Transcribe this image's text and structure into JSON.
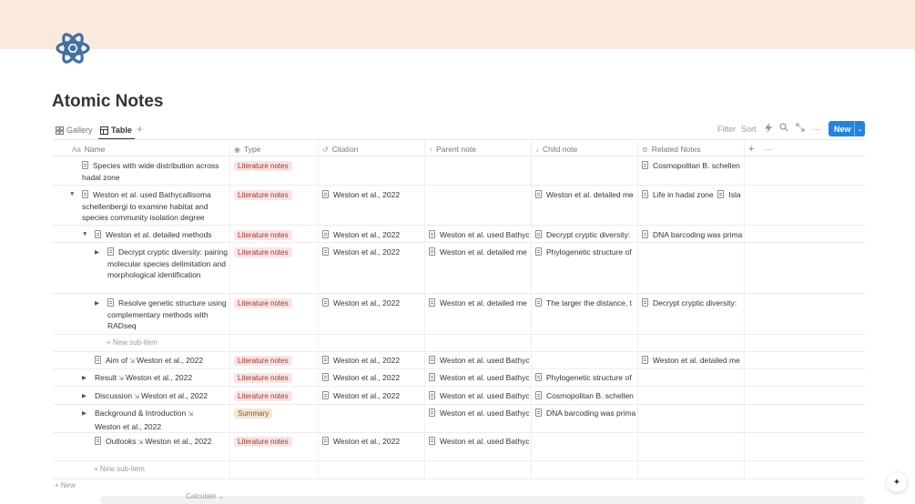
{
  "page": {
    "title": "Atomic Notes",
    "icon": "atom-icon"
  },
  "views": {
    "gallery": "Gallery",
    "table": "Table",
    "add": "+"
  },
  "toolbar": {
    "filter": "Filter",
    "sort": "Sort",
    "new": "New",
    "more": "···"
  },
  "columns": {
    "name": "Name",
    "name_prefix": "Aa",
    "type": "Type",
    "citation": "Citation",
    "parent": "Parent note",
    "child": "Child note",
    "related": "Related Notes",
    "add": "+",
    "more": "···"
  },
  "rows": [
    {
      "name": "Species with wide distribution across hadal zone",
      "type": "Literature notes",
      "citation": "",
      "parent": "",
      "child": "",
      "related": [
        "Cosmopolitan B. schellen"
      ]
    },
    {
      "name": "Weston et al. used Bathycallisoma schellenbergi to examine habitat and species community isolation degree",
      "type": "Literature notes",
      "citation": "Weston et al., 2022",
      "parent": "",
      "child": "Weston et al. detailed me",
      "related": [
        "Life in hadal zone",
        "Isla"
      ]
    },
    {
      "name": "Weston et al. detailed methods",
      "type": "Literature notes",
      "citation": "Weston et al., 2022",
      "parent": "Weston et al. used Bathyc",
      "child": "Decrypt cryptic diversity:",
      "related": [
        "DNA barcoding was prima"
      ]
    },
    {
      "name": "Decrypt cryptic diversity: pairing molecular species delimitation and morphological identification",
      "type": "Literature notes",
      "citation": "Weston et al., 2022",
      "parent": "Weston et al. detailed me",
      "child": "Phylogenetic structure of",
      "related": []
    },
    {
      "name": "Resolve genetic structure using complementary methods with RADseq",
      "type": "Literature notes",
      "citation": "Weston et al., 2022",
      "parent": "Weston et al. detailed me",
      "child": "The larger the distance, t",
      "related": [
        "Decrypt cryptic diversity:"
      ]
    },
    {
      "name_a": "Aim of",
      "name_b": "Weston et al., 2022",
      "type": "Literature notes",
      "citation": "Weston et al., 2022",
      "parent": "Weston et al. used Bathyc",
      "child": "",
      "related": [
        "Weston et al. detailed me"
      ]
    },
    {
      "name_a": "Result",
      "name_b": "Weston et al., 2022",
      "type": "Literature notes",
      "citation": "Weston et al., 2022",
      "parent": "Weston et al. used Bathyc",
      "child": "Phylogenetic structure of",
      "related": []
    },
    {
      "name_a": "Discussion",
      "name_b": "Weston et al., 2022",
      "type": "Literature notes",
      "citation": "Weston et al., 2022",
      "parent": "Weston et al. used Bathyc",
      "child": "Cosmopolitan B. schellen",
      "related": []
    },
    {
      "name_a": "Background & Introduction",
      "name_b": "Weston et al., 2022",
      "type": "Summary",
      "citation": "",
      "parent": "Weston et al. used Bathyc",
      "child": "DNA barcoding was prima",
      "related": []
    },
    {
      "name_a": "Outlooks",
      "name_b": "Weston et al., 2022",
      "type": "Literature notes",
      "citation": "Weston et al., 2022",
      "parent": "Weston et al. used Bathyc",
      "child": "",
      "related": []
    }
  ],
  "labels": {
    "new_sub_item": "+ New sub-item",
    "new": "+ New",
    "calculate": "Calculate ⌄"
  },
  "colors": {
    "accent": "#2383e2",
    "cover": "#fbeadc",
    "tag_literature": "#fbe4e4",
    "tag_summary": "#f3e7d5",
    "icon": "#3f6fa8"
  }
}
